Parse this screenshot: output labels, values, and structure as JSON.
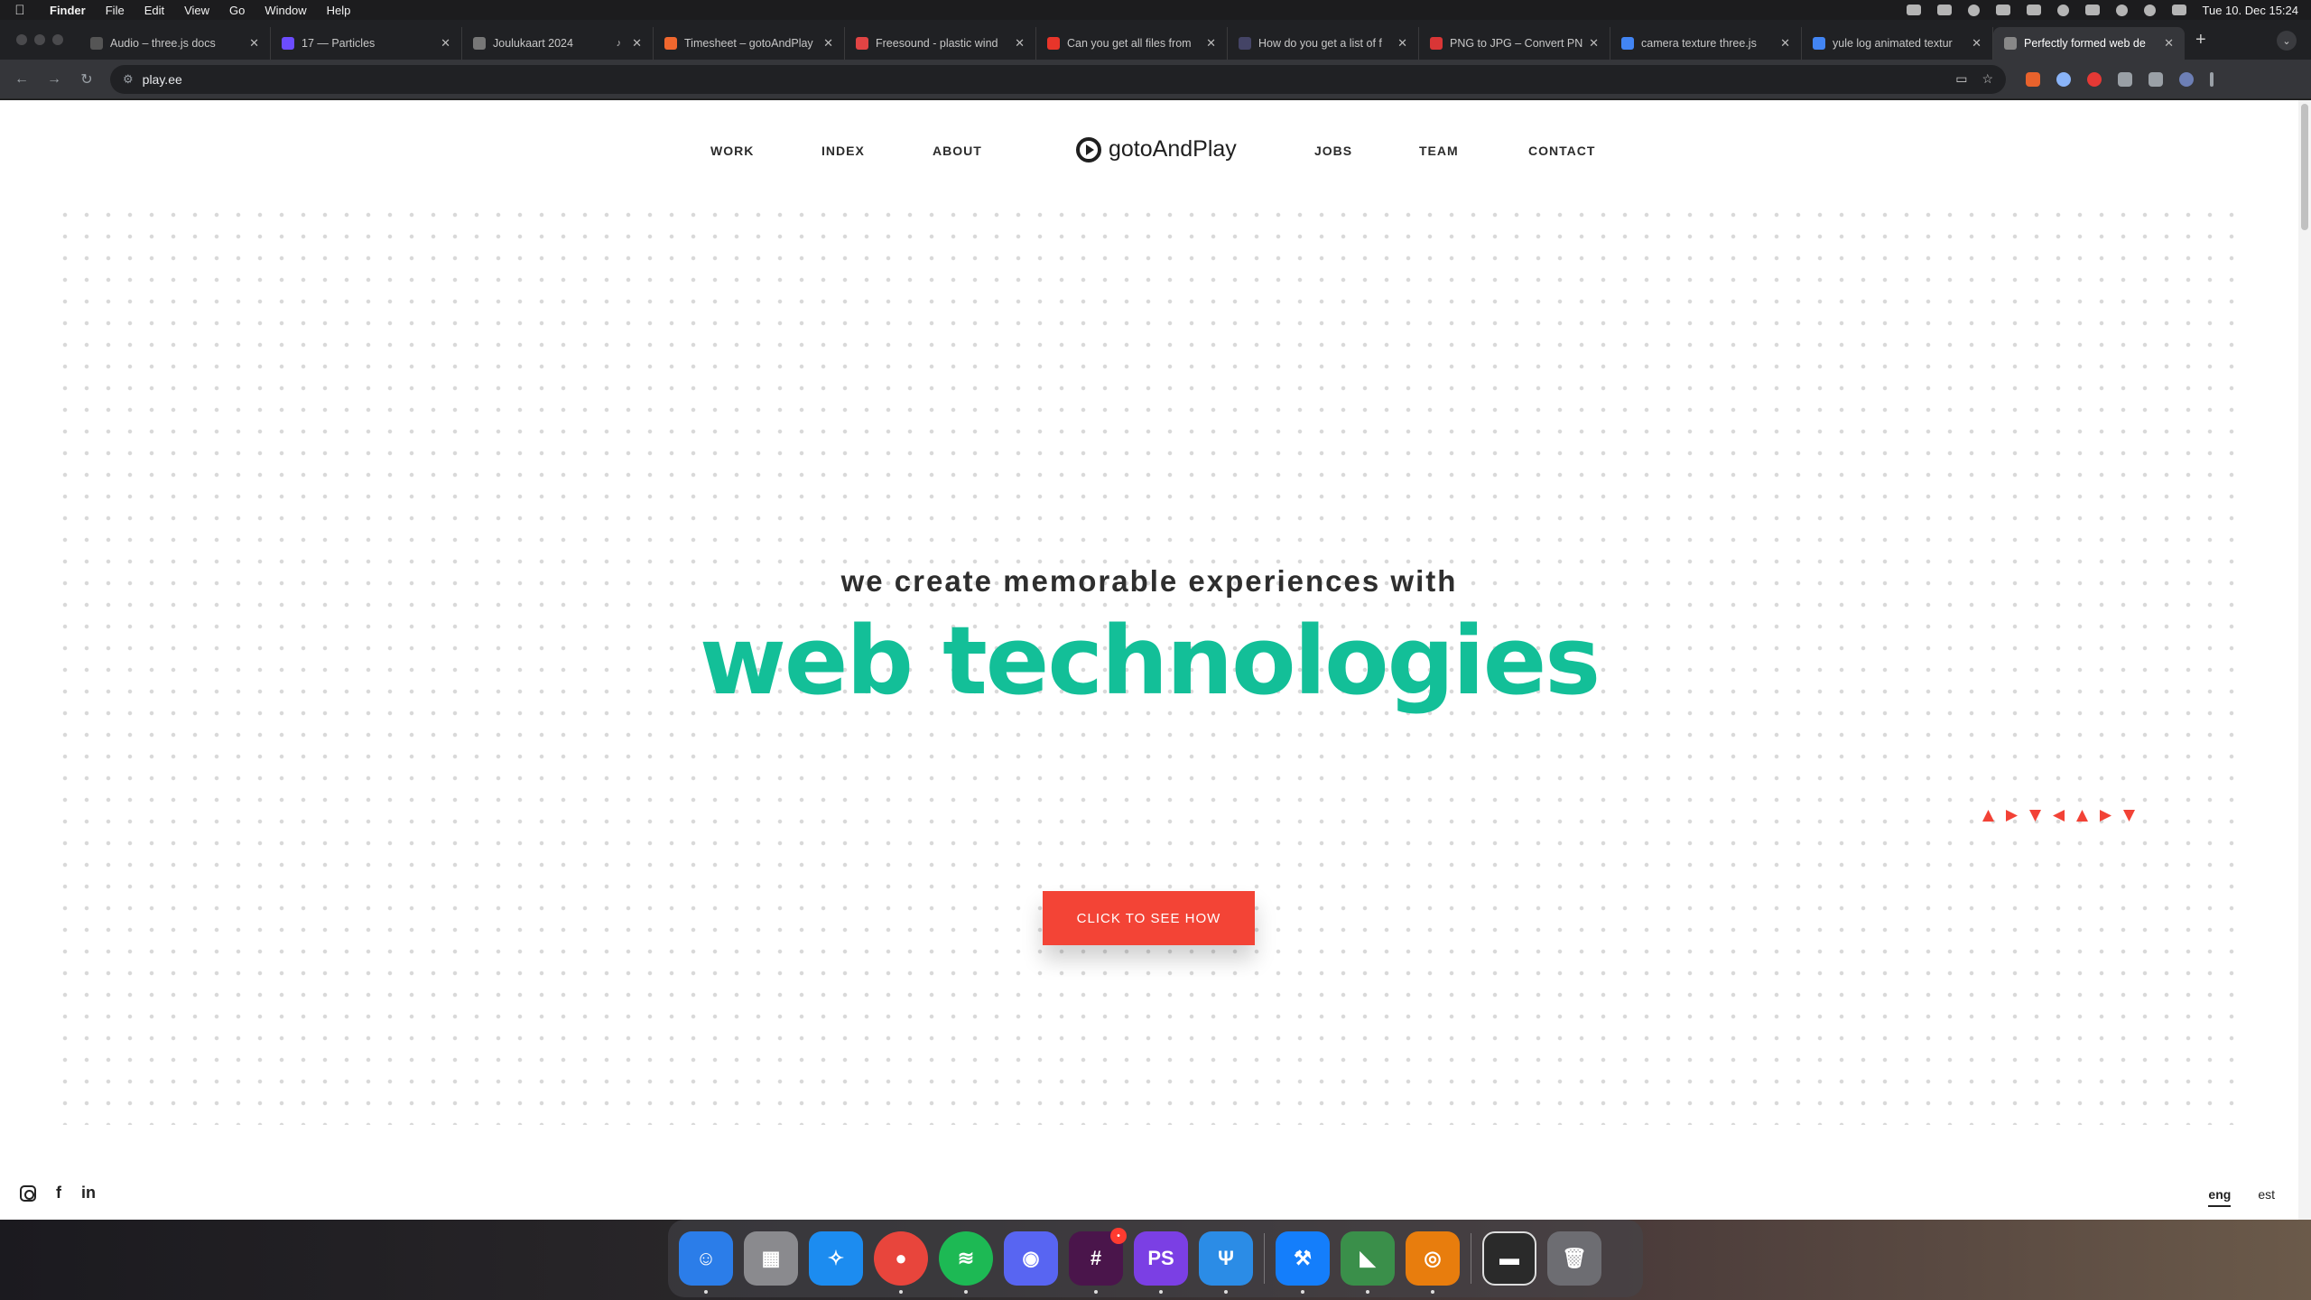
{
  "menubar": {
    "app": "Finder",
    "items": [
      "File",
      "Edit",
      "View",
      "Go",
      "Window",
      "Help"
    ],
    "clock": "Tue 10. Dec  15:24"
  },
  "tabs": [
    {
      "title": "Audio – three.js docs",
      "color": "#555555"
    },
    {
      "title": "17 — Particles",
      "color": "#6c4cff"
    },
    {
      "title": "Joulukaart 2024",
      "color": "#777777"
    },
    {
      "title": "Timesheet – gotoAndPlay",
      "color": "#f0672e"
    },
    {
      "title": "Freesound - plastic wind",
      "color": "#e04444"
    },
    {
      "title": "Can you get all files from",
      "color": "#e8352a"
    },
    {
      "title": "How do you get a list of f",
      "color": "#444466"
    },
    {
      "title": "PNG to JPG – Convert PN",
      "color": "#d93636"
    },
    {
      "title": "camera texture three.js",
      "color": "#4285f4"
    },
    {
      "title": "yule log animated textur",
      "color": "#4285f4"
    },
    {
      "title": "Perfectly formed web de",
      "color": "#888888"
    }
  ],
  "omnibox": {
    "url": "play.ee"
  },
  "site": {
    "nav": [
      "WORK",
      "INDEX",
      "ABOUT",
      "JOBS",
      "TEAM",
      "CONTACT"
    ],
    "logo": "gotoAndPlay",
    "tagline": "we create memorable experiences with",
    "headline": "web technologies",
    "cta": "CLICK TO SEE HOW",
    "lang": [
      "eng",
      "est"
    ],
    "accent": "#13bf98",
    "cta_color": "#f34436"
  },
  "dock": {
    "apps": [
      {
        "name": "Finder",
        "color": "#2b7de9"
      },
      {
        "name": "Launchpad",
        "color": "#8a8a8e"
      },
      {
        "name": "Safari",
        "color": "#1c8cf0"
      },
      {
        "name": "Chrome",
        "color": "#e8453c"
      },
      {
        "name": "Spotify",
        "color": "#1db954"
      },
      {
        "name": "Discord",
        "color": "#5865f2"
      },
      {
        "name": "Slack",
        "color": "#4a154b"
      },
      {
        "name": "PhpStorm",
        "color": "#7b3fe4"
      },
      {
        "name": "Fork",
        "color": "#2b8ce6"
      },
      {
        "name": "Xcode",
        "color": "#147efb"
      },
      {
        "name": "Affinity",
        "color": "#3a8f4a"
      },
      {
        "name": "Blender",
        "color": "#e87d0d"
      }
    ],
    "slack_badge": "•"
  }
}
